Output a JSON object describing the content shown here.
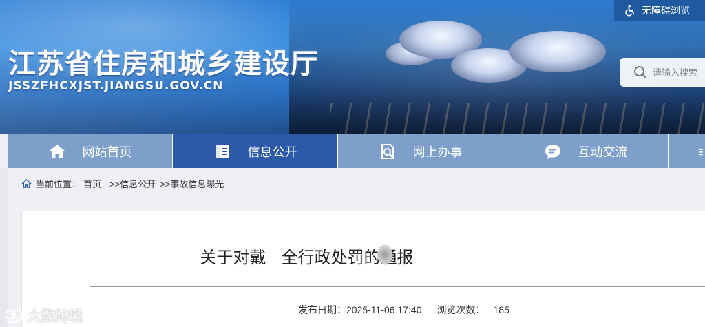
{
  "header": {
    "site_title": "江苏省住房和城乡建设厅",
    "site_domain": "JSSZFHCXJST.JIANGSU.GOV.CN",
    "accessibility_label": "无障碍浏览",
    "search_placeholder": "请输入搜索"
  },
  "nav": {
    "items": [
      {
        "label": "网站首页",
        "icon": "home-icon"
      },
      {
        "label": "信息公开",
        "icon": "document-icon",
        "active": true
      },
      {
        "label": "网上办事",
        "icon": "search-document-icon"
      },
      {
        "label": "互动交流",
        "icon": "chat-icon"
      }
    ]
  },
  "breadcrumb": {
    "prefix": "当前位置：",
    "home": "首页",
    "level1": ">>信息公开",
    "level2": ">>事故信息曝光"
  },
  "article": {
    "title_part1": "关于对戴",
    "title_part2": "全行政处罚的通报",
    "date_label": "发布日期：",
    "date": "2025-11-06 17:40",
    "views_label": "浏览次数：",
    "views": "185"
  },
  "watermark": {
    "text": "大数跨境"
  },
  "colors": {
    "nav_bg": "#7e9fca",
    "nav_active": "#2c5aa8",
    "access_bg": "#1f5aa0"
  }
}
